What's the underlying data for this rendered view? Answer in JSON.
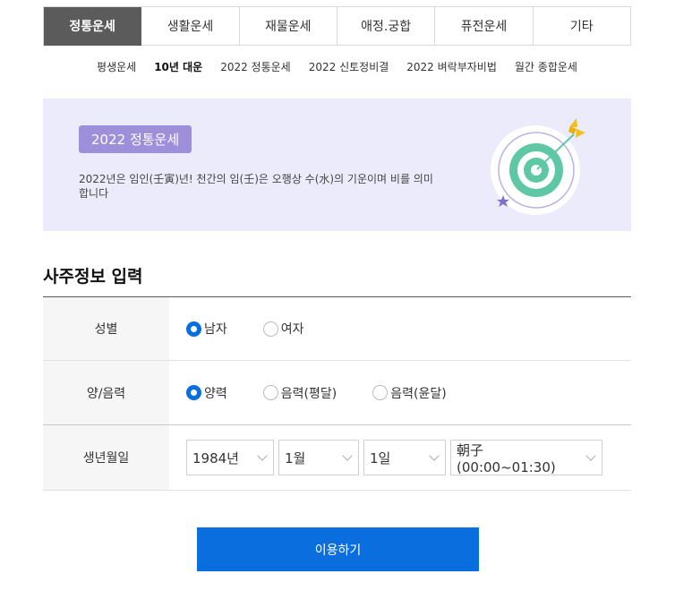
{
  "tabs": [
    "정통운세",
    "생활운세",
    "재물운세",
    "애정.궁합",
    "퓨전운세",
    "기타"
  ],
  "active_tab": "정통운세",
  "subnav": [
    "평생운세",
    "10년 대운",
    "2022 정통운세",
    "2022 신토정비결",
    "2022 벼락부자비법",
    "월간 종합운세"
  ],
  "active_subnav": "10년 대운",
  "banner": {
    "badge": "2022 정통운세",
    "description": "2022년은 임인(壬寅)년! 천간의 임(壬)은 오행상 수(水)의 기운이며 비를 의미합니다",
    "icon": "target-arrow-icon",
    "colors": {
      "background": "#ecebfc",
      "badge": "#9d8fd9",
      "target_outer": "#5ec8a4",
      "arrow": "#f2c01e"
    }
  },
  "form": {
    "title": "사주정보 입력",
    "rows": {
      "gender": {
        "label": "성별",
        "options": [
          "남자",
          "여자"
        ],
        "selected": "남자"
      },
      "calendar": {
        "label": "양/음력",
        "options": [
          "양력",
          "음력(평달)",
          "음력(윤달)"
        ],
        "selected": "양력"
      },
      "birth": {
        "label": "생년월일",
        "year": "1984년",
        "month": "1월",
        "day": "1일",
        "time": "朝子(00:00~01:30)"
      }
    }
  },
  "submit_label": "이용하기",
  "colors": {
    "accent": "#0a6edf",
    "active_tab": "#5b5b5b"
  }
}
